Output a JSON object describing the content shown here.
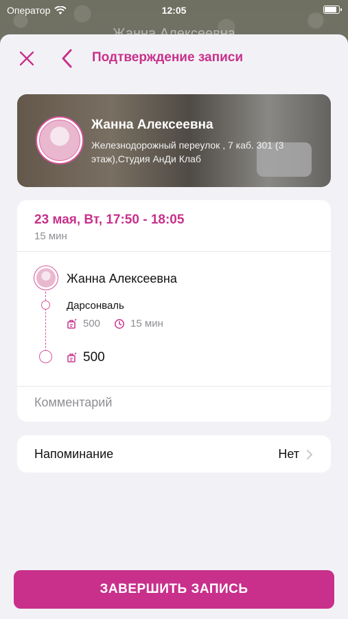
{
  "status_bar": {
    "carrier": "Оператор",
    "time": "12:05",
    "battery_level": 0.9
  },
  "background_title": "Жанна Алексеевна",
  "nav": {
    "title": "Подтверждение записи",
    "close_icon": "close-icon",
    "back_icon": "chevron-left-icon"
  },
  "salon": {
    "name": "Жанна Алексеевна",
    "address": "Железнодорожный переулок , 7 каб. 301 (3 этаж),Студия АнДи Клаб"
  },
  "appointment": {
    "date_time": "23 мая, Вт, 17:50 - 18:05",
    "duration": "15 мин",
    "master_name": "Жанна Алексеевна",
    "service": {
      "name": "Дарсонваль",
      "price": "500",
      "duration": "15 мин"
    },
    "total": "500",
    "comment_placeholder": "Комментарий"
  },
  "reminder": {
    "label": "Напоминание",
    "value": "Нет"
  },
  "submit_label": "ЗАВЕРШИТЬ ЗАПИСЬ",
  "colors": {
    "accent": "#c8308b",
    "background": "#f2f2f6",
    "secondary_text": "#8e8e93"
  }
}
